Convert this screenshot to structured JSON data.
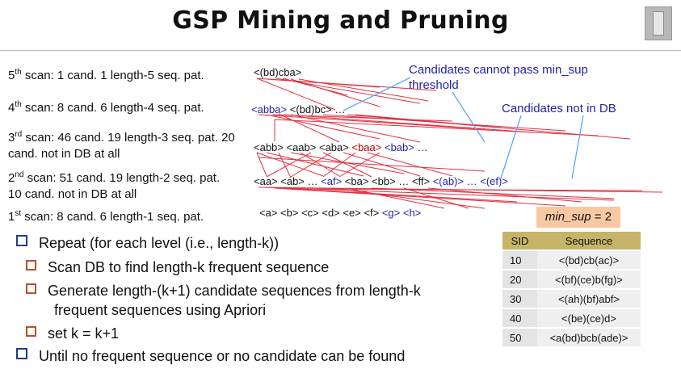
{
  "title": "GSP Mining and Pruning",
  "scans": [
    {
      "ord": "5",
      "sup": "th",
      "text": " scan: 1 cand. 1 length-5 seq. pat."
    },
    {
      "ord": "4",
      "sup": "th",
      "text": " scan: 8 cand. 6 length-4 seq. pat."
    },
    {
      "ord": "3",
      "sup": "rd",
      "text": " scan: 46 cand. 19 length-3 seq. pat. 20",
      "line2": "cand. not in DB at all"
    },
    {
      "ord": "2",
      "sup": "nd",
      "text": " scan: 51 cand. 19 length-2 seq. pat.",
      "line2": "10 cand. not in DB at all"
    },
    {
      "ord": "1",
      "sup": "st",
      "text": " scan: 8 cand. 6 length-1 seq. pat."
    }
  ],
  "candidates": {
    "l5": "<(bd)cba>",
    "l4_blue": "<abba>",
    "l4_black": "<(bd)bc> …",
    "l3_black": "<abb> <aab> <aba>",
    "l3_red": "<baa>",
    "l3_blue": "<bab>",
    "l3_end": "…",
    "l2_a": "<aa> <ab> …",
    "l2_b": "<af>",
    "l2_c": "<ba> <bb> … <ff>",
    "l2_d": "<(ab)> … <(ef)>",
    "l1_black": "<a> <b> <c> <d> <e> <f>",
    "l1_blue": "<g> <h>"
  },
  "callouts": {
    "min_sup_line1": "Candidates cannot pass min_sup",
    "min_sup_line2": "threshold",
    "not_in_db": "Candidates not in DB"
  },
  "bullets": {
    "repeat": "Repeat (for each level (i.e., length-k))",
    "scan_db": "Scan DB to find length-k frequent sequence",
    "generate_line1": "Generate length-(k+1) candidate sequences from length-k",
    "generate_line2": "frequent sequences using Apriori",
    "set_k": "set k = k+1",
    "until": "Until no frequent sequence or no candidate can be found"
  },
  "min_sup": {
    "label": "min_sup",
    "value": " = 2"
  },
  "table": {
    "headers": [
      "SID",
      "Sequence"
    ],
    "rows": [
      [
        "10",
        "<(bd)cb(ac)>"
      ],
      [
        "20",
        "<(bf)(ce)b(fg)>"
      ],
      [
        "30",
        "<(ah)(bf)abf>"
      ],
      [
        "40",
        "<(be)(ce)d>"
      ],
      [
        "50",
        "<a(bd)bcb(ade)>"
      ]
    ]
  },
  "colors": {
    "blue": "#1f1fb4",
    "red_text": "#c00000",
    "strike": "#e03040",
    "callout": "#2222aa",
    "header_fill": "#c6b468",
    "minsup_fill": "#f7c9a3"
  }
}
